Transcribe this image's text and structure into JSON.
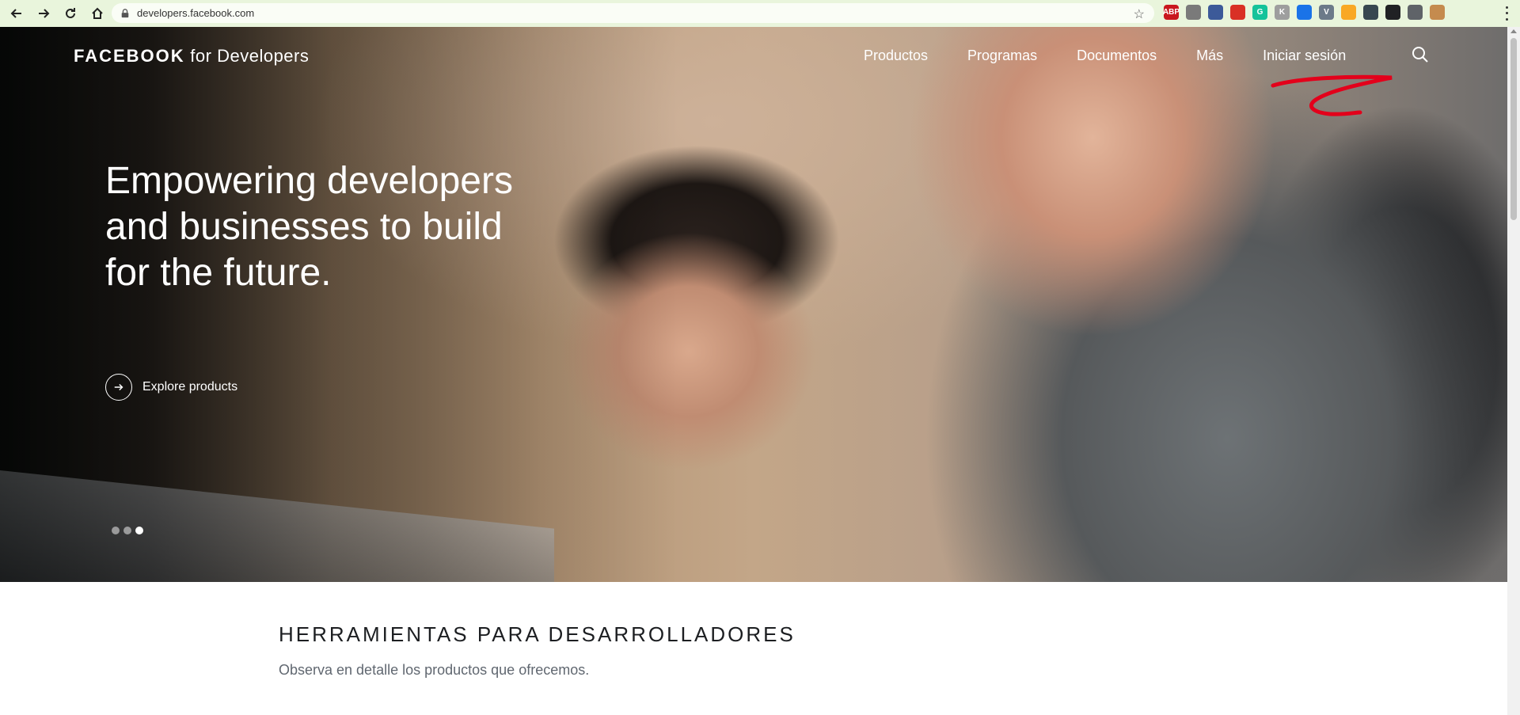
{
  "browser": {
    "url": "developers.facebook.com",
    "extensions": [
      {
        "name": "adblock-plus-icon",
        "label": "ABP",
        "color": "#c9171e"
      },
      {
        "name": "globe-extension-icon",
        "label": "",
        "color": "#7a7a7a"
      },
      {
        "name": "table-extension-icon",
        "label": "",
        "color": "#3c5a99"
      },
      {
        "name": "red-grid-extension-icon",
        "label": "",
        "color": "#d93025"
      },
      {
        "name": "grammarly-icon",
        "label": "G",
        "color": "#15c39a"
      },
      {
        "name": "k-extension-icon",
        "label": "K",
        "color": "#9e9e9e"
      },
      {
        "name": "pen-extension-icon",
        "label": "",
        "color": "#1a73e8"
      },
      {
        "name": "v-extension-icon",
        "label": "V",
        "color": "#6c7a89"
      },
      {
        "name": "pencil-extension-icon",
        "label": "",
        "color": "#f9a825"
      },
      {
        "name": "car-extension-icon",
        "label": "",
        "color": "#37474f"
      },
      {
        "name": "slash-extension-icon",
        "label": "",
        "color": "#202124"
      },
      {
        "name": "puzzle-extensions-icon",
        "label": "",
        "color": "#5f6368"
      },
      {
        "name": "profile-avatar-icon",
        "label": "",
        "color": "#c58b4e"
      }
    ]
  },
  "header": {
    "brand_bold": "FACEBOOK",
    "brand_rest": " for Developers",
    "nav": [
      "Productos",
      "Programas",
      "Documentos",
      "Más",
      "Iniciar sesión"
    ]
  },
  "hero": {
    "headline": "Empowering developers and businesses to build for the future.",
    "cta_label": "Explore products",
    "slides_total": 3,
    "slide_active": 3
  },
  "section": {
    "title": "HERRAMIENTAS PARA DESARROLLADORES",
    "subtitle": "Observa en detalle los productos que ofrecemos."
  }
}
